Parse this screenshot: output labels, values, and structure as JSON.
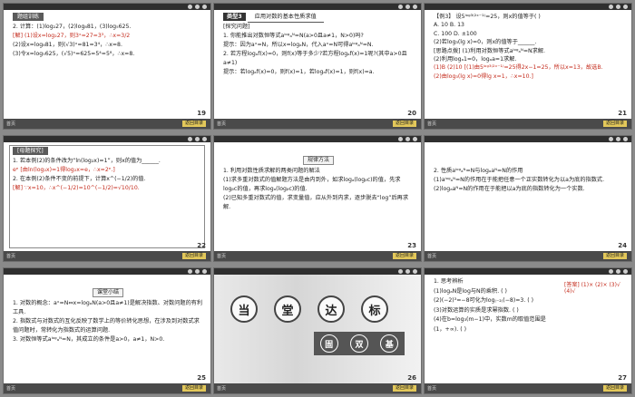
{
  "slides": [
    {
      "page": "19",
      "header": "题组训练",
      "lines": [
        "2. 计算：(1)log₂27，(2)log₈81，(3)log₅625.",
        "[解] (1)设x=log₂27，则3ˣ=27=3³，∴x=3/2",
        "(2)设x=log₈81，则(√3)ˣ=81=3⁴，∴x=8.",
        "(3)令x=log₅625，(√5)ˣ=625=5⁴=5⁸，∴x=8."
      ],
      "footer_left": "首页",
      "footer_btn": "返回目录"
    },
    {
      "page": "20",
      "type_tag": "类型3",
      "type_title": "应用对数的基本性质求值",
      "sub": "[探究问题]",
      "lines": [
        "1. 你能推出对数恒等式aˡᵒᵍₐᴺ=N(a>0且a≠1，N>0)吗?",
        "提示：因为aˣ=N，所以x=logₐN，代入aˣ=N可得aˡᵒᵍₐᴺ=N.",
        "2. 若方程logₐf(x)=0，则f(x)等于多少?若方程logₐf(x)=1呢?(其中a>0且a≠1)",
        "提示：若logₐf(x)=0，则f(x)=1，若logₐf(x)=1，则f(x)=a."
      ],
      "footer_left": "首页",
      "footer_btn": "返回目录"
    },
    {
      "page": "21",
      "lines": [
        "【例3】 设5ˡᵒᵍ³⁽²ˣ⁻¹⁾=25，则x的值等于(     )",
        "A. 10          B. 13",
        "C. 100         D. ±100",
        "(2)若log₃(lg x)=0，则x的值等于______.",
        "[思路点拨] (1)利用对数恒等式aˡᵒᵍₐᴺ=N求解.",
        "(2)利用logₐ1=0，logₐa=1求解.",
        "(1)B  (2)10  [(1)由5ˡᵒᵍ³⁽²ˣ⁻¹⁾=25得2x−1=25，所以x=13，故选B.",
        "(2)由log₃(lg x)=0得lg x=1，∴x=10.]"
      ],
      "footer_left": "首页",
      "footer_btn": "返回目录"
    },
    {
      "page": "22",
      "header": "[母题探究]",
      "lines": [
        "1. 若本例(2)的条件改为“ln(log₂x)=1”，则x的值为______.",
        "eᵉ [由ln(log₂x)=1得log₂x=e，∴x=2ᵉ.]",
        "2. 在本例(2)条件不变的前提下，计算x^(−1/2)的值.",
        "[解] ∵x=10，∴x^(−1/2)=10^(−1/2)=√10/10."
      ],
      "footer_left": "首页",
      "footer_btn": "返回目录"
    },
    {
      "page": "23",
      "tag": "规律方法",
      "lines": [
        "1. 利用对数性质求解的两类问题的解法",
        "(1)求多重对数式的值解题方法是由内到外，如求logₐ(logᵦc)的值，先求logᵦc的值，再求logₐ(logᵦc)的值.",
        "(2)已知多重对数式的值，求变量值，应从外到内求，逐步脱去“log”后再求解."
      ],
      "footer_left": "首页",
      "footer_btn": "返回目录"
    },
    {
      "page": "24",
      "lines": [
        "2. 性质aˡᵒᵍₐᴺ=N与logₐaᴺ=N的作用",
        "(1)aˡᵒᵍₐᴺ=N的作用在于能把任意一个正实数转化为以a为底的指数式.",
        "(2)logₐaᴺ=N的作用在于能把以a为底的指数转化为一个实数."
      ],
      "footer_left": "首页",
      "footer_btn": "返回目录"
    },
    {
      "page": "25",
      "tag": "课堂小结",
      "lines": [
        "1. 对数的概念：aˣ=N⇔x=logₐN(a>0且a≠1)是解决指数、对数问题的有利工具.",
        "2. 指数式与对数式的互化反映了数学上的等价转化思想，在涉及到对数式求值问题时，常转化为指数式的运算问题.",
        "3. 对数恒等式aˡᵒᵍₐᴺ=N，其成立的条件是a>0，a≠1，N>0."
      ],
      "footer_left": "首页",
      "footer_btn": "返回目录"
    },
    {
      "page": "26",
      "big_chars": [
        "当",
        "堂",
        "达",
        "标"
      ],
      "small_chars": [
        "固",
        "双",
        "基"
      ],
      "footer_left": "首页",
      "footer_btn": "返回目录"
    },
    {
      "page": "27",
      "lines": [
        "1. 思考辨析",
        "(1)logₐN是log与N的乘积.  (     )",
        "(2)(−2)³=−8可化为log₍₋₂₎(−8)=3.  (     )",
        "(3)对数运算的实质是求幂指数.  (     )",
        "(4)在b=log₃(m−1)中，实数m的取值范围是(1，+∞).  (     )"
      ],
      "answer": "[答案] (1)×  (2)×  (3)√  (4)√",
      "footer_left": "首页",
      "footer_btn": "返回目录"
    }
  ]
}
